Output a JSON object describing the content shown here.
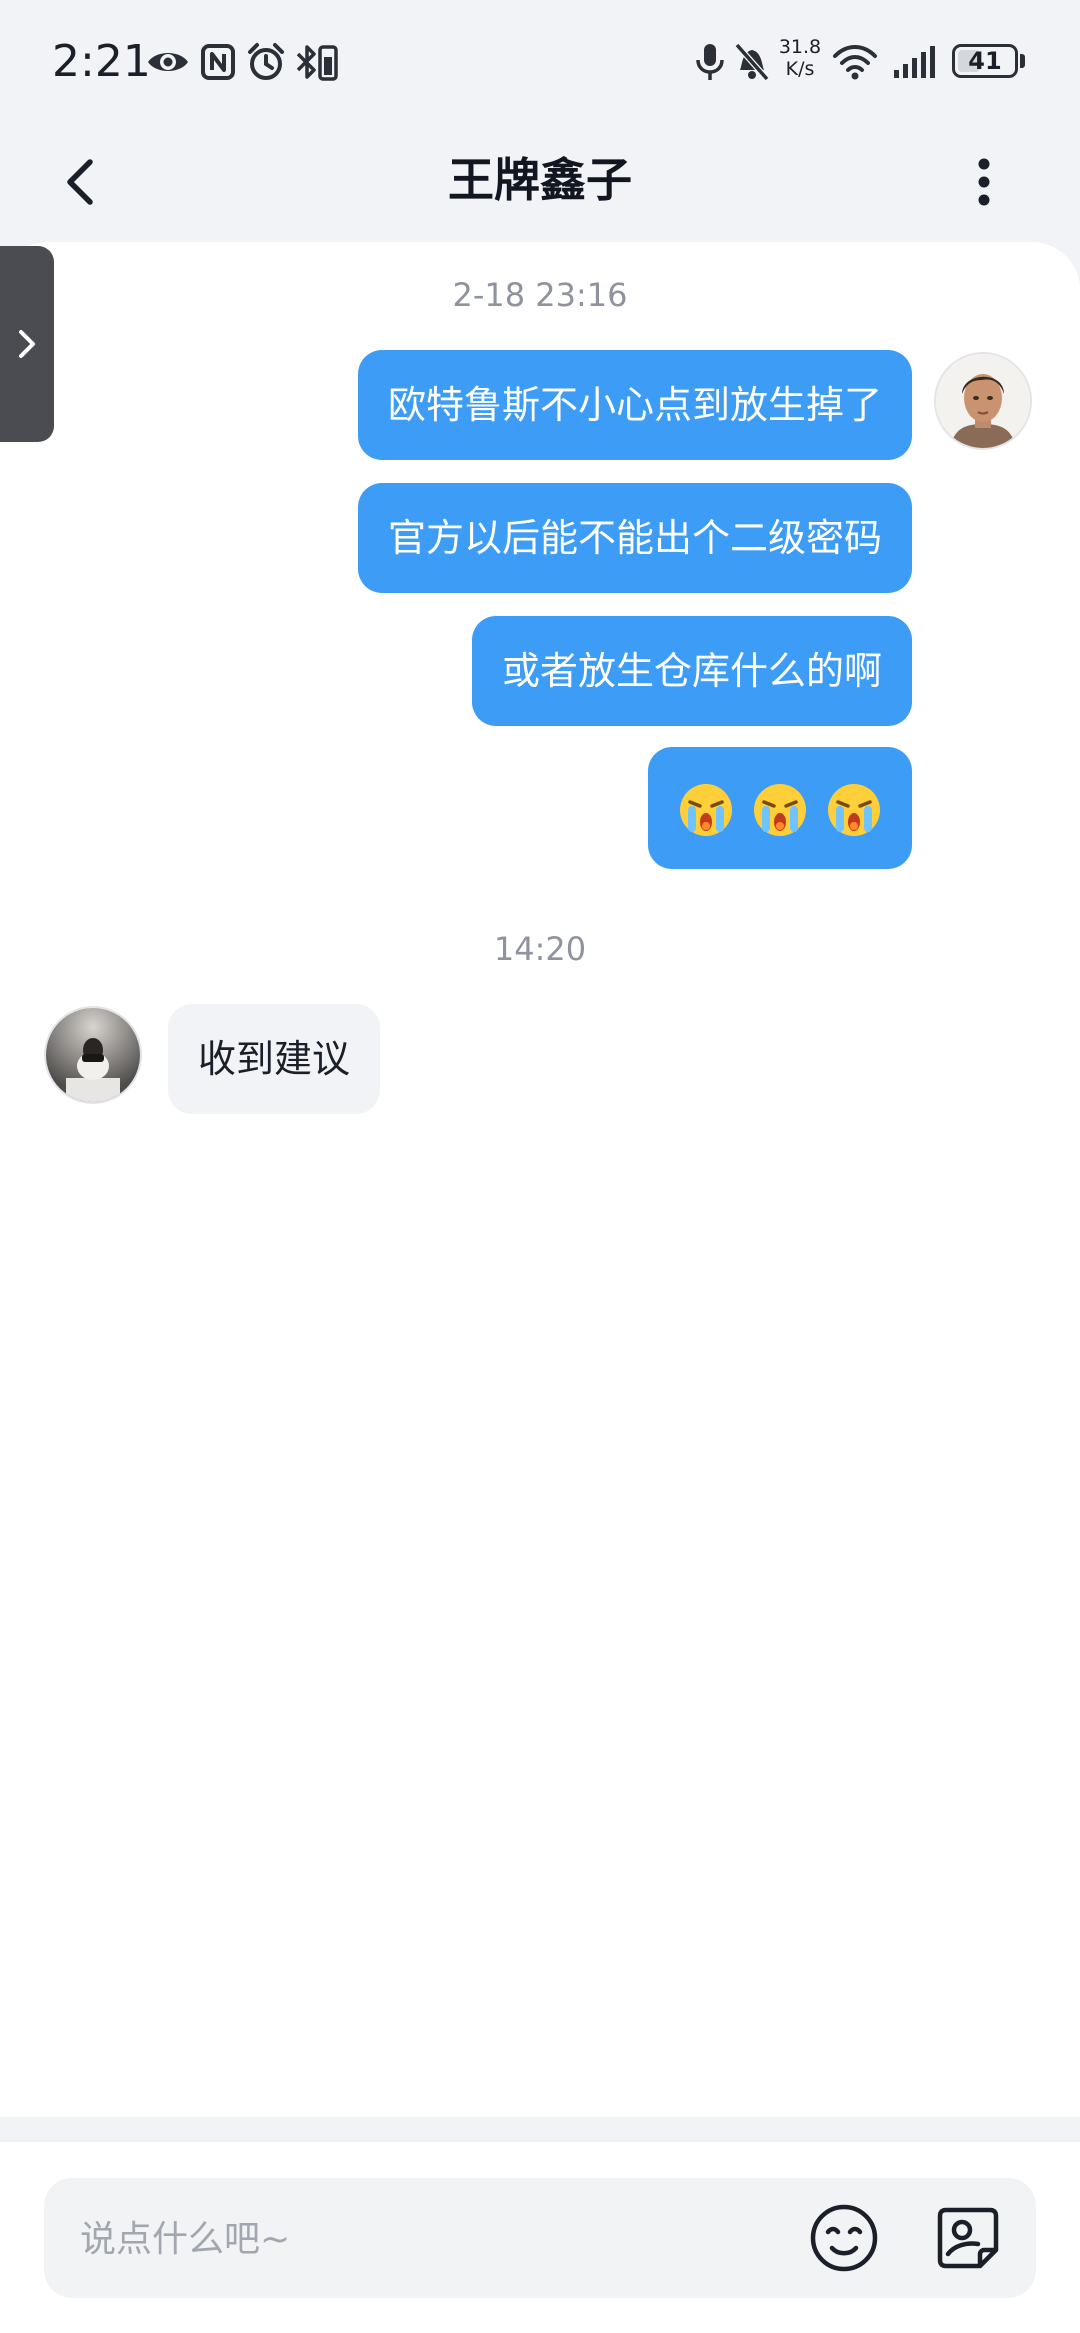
{
  "status_bar": {
    "time": "2:21",
    "net_speed_value": "31.8",
    "net_speed_unit": "K/s",
    "battery_level": "41",
    "battery_fraction": 0.41,
    "left_icons": [
      "eye-icon",
      "nfc-icon",
      "alarm-icon",
      "bluetooth-battery-icon"
    ],
    "right_icons": [
      "microphone-icon",
      "mute-bell-icon",
      "wifi-icon",
      "cellular-signal-icon",
      "battery-icon"
    ]
  },
  "header": {
    "title": "王牌鑫子",
    "back_icon": "chevron-left-icon",
    "more_icon": "more-vertical-icon"
  },
  "side_tab": {
    "icon": "chevron-right-icon"
  },
  "chat": {
    "groups": [
      {
        "timestamp": "2-18 23:16",
        "messages": [
          {
            "direction": "out",
            "text": "欧特鲁斯不小心点到放生掉了"
          },
          {
            "direction": "out",
            "text": "官方以后能不能出个二级密码"
          },
          {
            "direction": "out",
            "text": "或者放生仓库什么的啊"
          },
          {
            "direction": "out",
            "emoji": [
              "crying-emoji",
              "crying-emoji",
              "crying-emoji"
            ]
          }
        ]
      },
      {
        "timestamp": "14:20",
        "messages": [
          {
            "direction": "in",
            "text": "收到建议"
          }
        ]
      }
    ]
  },
  "input": {
    "placeholder": "说点什么吧~",
    "value": "",
    "emoji_icon": "smiley-icon",
    "sticker_icon": "sticker-icon"
  },
  "colors": {
    "background": "#f1f3f7",
    "outgoing_bubble": "#3d9cf5",
    "incoming_bubble": "#f2f3f7",
    "timestamp_text": "#8e939d",
    "side_tab": "#4a4c51"
  }
}
